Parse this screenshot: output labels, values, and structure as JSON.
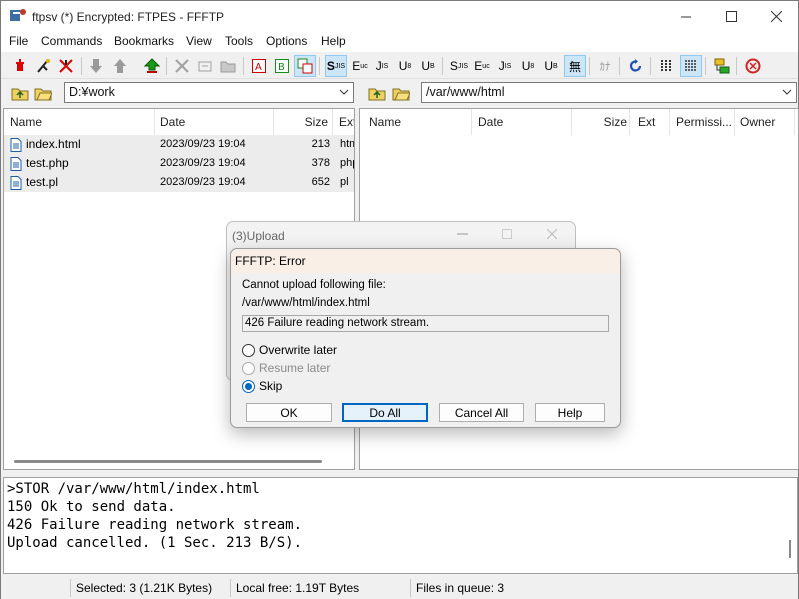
{
  "window": {
    "title": "ftpsv (*) Encrypted: FTPES - FFFTP"
  },
  "menu": [
    "File",
    "Commands",
    "Bookmarks",
    "View",
    "Tools",
    "Options",
    "Help"
  ],
  "toolbar_text": {
    "sjis1": "S",
    "euc1": "E",
    "jis1": "J",
    "utf1": "U",
    "utf2": "U",
    "sjis2": "S",
    "euc2": "E",
    "jis2": "J",
    "utf3": "U",
    "utf4": "U",
    "none": "無",
    "kana": "ｶﾅ"
  },
  "local": {
    "path": "D:¥work",
    "columns": [
      "Name",
      "Date",
      "Size",
      "Ext"
    ],
    "files": [
      {
        "name": "index.html",
        "date": "2023/09/23 19:04",
        "size": "213",
        "ext": "htm"
      },
      {
        "name": "test.php",
        "date": "2023/09/23 19:04",
        "size": "378",
        "ext": "php"
      },
      {
        "name": "test.pl",
        "date": "2023/09/23 19:04",
        "size": "652",
        "ext": "pl"
      }
    ]
  },
  "remote": {
    "path": "/var/www/html",
    "columns": [
      "Name",
      "Date",
      "Size",
      "Ext",
      "Permissi...",
      "Owner"
    ]
  },
  "upload_window": {
    "title": "(3)Upload"
  },
  "error_dialog": {
    "title": "FFFTP: Error",
    "message": "Cannot upload following file:",
    "file": "/var/www/html/index.html",
    "reason": "426 Failure reading network stream.",
    "options": [
      {
        "label": "Overwrite later",
        "state": "normal"
      },
      {
        "label": "Resume later",
        "state": "disabled"
      },
      {
        "label": "Skip",
        "state": "selected"
      }
    ],
    "buttons": {
      "ok": "OK",
      "do_all": "Do All",
      "cancel_all": "Cancel All",
      "help": "Help"
    }
  },
  "log": [
    ">STOR /var/www/html/index.html",
    "150 Ok to send data.",
    "426 Failure reading network stream.",
    "Upload cancelled. (1 Sec. 213 B/S)."
  ],
  "status": {
    "selected": "Selected: 3 (1.21K Bytes)",
    "local_free": "Local free: 1.19T Bytes",
    "queue": "Files in queue: 3"
  },
  "colors": {
    "accent": "#0067c0",
    "dialog_title_bg": "#f9efe6"
  }
}
